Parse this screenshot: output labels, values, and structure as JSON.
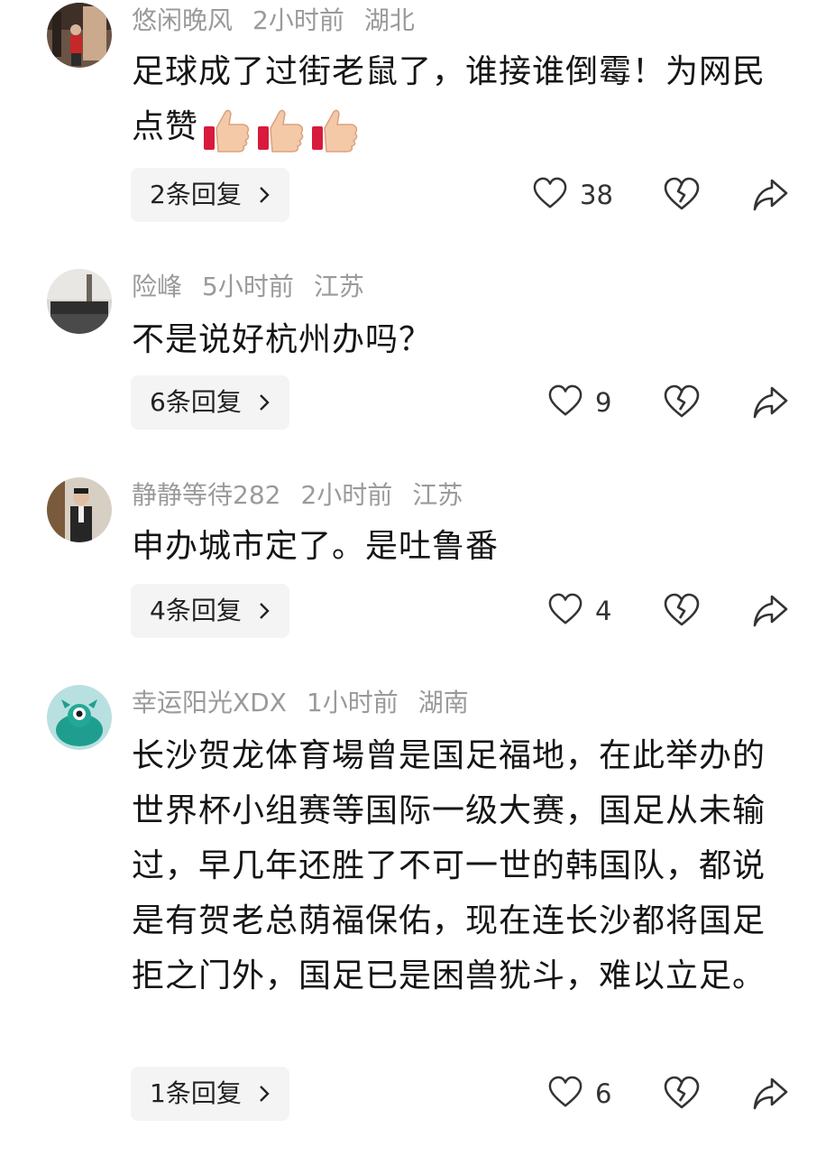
{
  "comments": [
    {
      "user": "悠闲晚风",
      "time": "2小时前",
      "location": "湖北",
      "text": "足球成了过街老鼠了，谁接谁倒霉！为网民点赞",
      "reactions": [
        "thumbs-up-emoji",
        "thumbs-up-emoji",
        "thumbs-up-emoji"
      ],
      "replies": "2条回复",
      "likes": "38"
    },
    {
      "user": "险峰",
      "time": "5小时前",
      "location": "江苏",
      "text": "不是说好杭州办吗？",
      "replies": "6条回复",
      "likes": "9"
    },
    {
      "user": "静静等待282",
      "time": "2小时前",
      "location": "江苏",
      "text": "申办城市定了。是吐鲁番",
      "replies": "4条回复",
      "likes": "4"
    },
    {
      "user": "幸运阳光XDX",
      "time": "1小时前",
      "location": "湖南",
      "text": "长沙贺龙体育場曾是国足福地，在此举办的世界杯小组赛等国际一级大赛，国足从未输过，早几年还胜了不可一世的韩国队，都说是有贺老总荫福保佑，现在连长沙都将国足拒之门外，国足已是困兽犹斗，难以立足。",
      "replies": "1条回复",
      "likes": "6"
    }
  ],
  "icons": {
    "like": "heart-outline-icon",
    "dislike": "broken-heart-icon",
    "share": "share-arrow-icon",
    "chevron": "chevron-right-icon"
  },
  "colors": {
    "meta_text": "#9a9a9a",
    "body_text": "#151515",
    "reply_bg": "#f4f4f4",
    "icon_stroke": "#333333"
  }
}
